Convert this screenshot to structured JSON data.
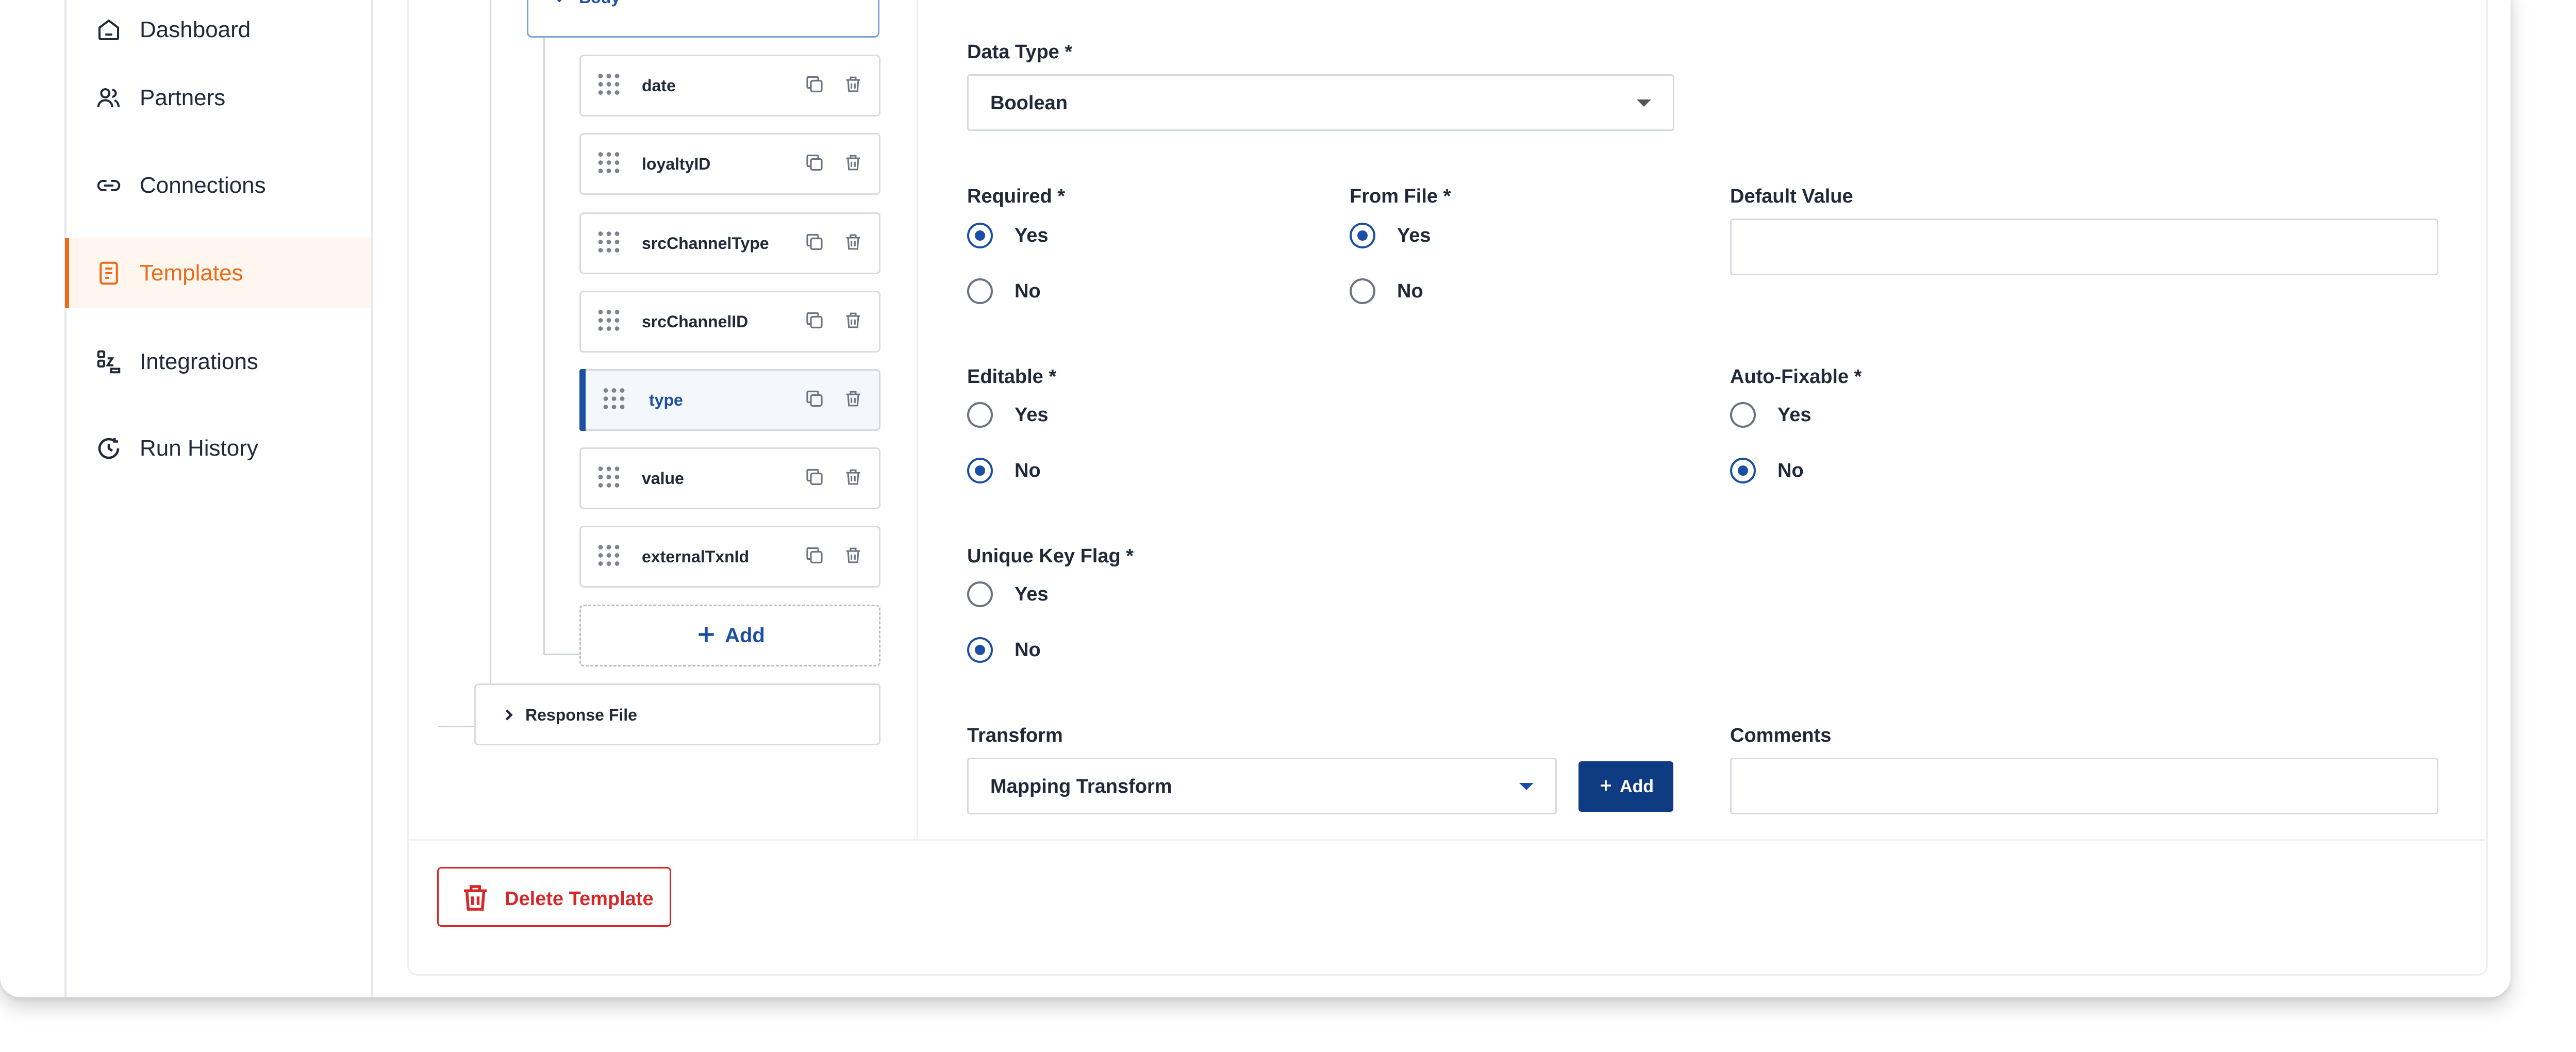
{
  "sidebar": {
    "items": [
      {
        "label": "Dashboard",
        "icon": "home-icon"
      },
      {
        "label": "Partners",
        "icon": "users-icon"
      },
      {
        "label": "Connections",
        "icon": "link-icon"
      },
      {
        "label": "Templates",
        "icon": "document-icon",
        "active": true
      },
      {
        "label": "Integrations",
        "icon": "integrations-icon"
      },
      {
        "label": "Run History",
        "icon": "history-icon"
      }
    ]
  },
  "tree": {
    "body_label": "Body",
    "fields": [
      {
        "label": "date"
      },
      {
        "label": "loyaltyID"
      },
      {
        "label": "srcChannelType"
      },
      {
        "label": "srcChannelID"
      },
      {
        "label": "type",
        "selected": true
      },
      {
        "label": "value"
      },
      {
        "label": "externalTxnId"
      }
    ],
    "add_label": "Add",
    "response_label": "Response File"
  },
  "form": {
    "data_type": {
      "label": "Data Type *",
      "value": "Boolean"
    },
    "required": {
      "label": "Required *",
      "yes": "Yes",
      "no": "No",
      "selected": "Yes"
    },
    "from_file": {
      "label": "From File *",
      "yes": "Yes",
      "no": "No",
      "selected": "Yes"
    },
    "default_value": {
      "label": "Default Value",
      "value": ""
    },
    "editable": {
      "label": "Editable *",
      "yes": "Yes",
      "no": "No",
      "selected": "No"
    },
    "auto_fixable": {
      "label": "Auto-Fixable *",
      "yes": "Yes",
      "no": "No",
      "selected": "No"
    },
    "unique_key": {
      "label": "Unique Key Flag *",
      "yes": "Yes",
      "no": "No",
      "selected": "No"
    },
    "transform": {
      "label": "Transform",
      "value": "Mapping Transform",
      "add_label": "Add"
    },
    "comments": {
      "label": "Comments",
      "value": ""
    }
  },
  "footer": {
    "delete_label": "Delete Template"
  },
  "colors": {
    "accent": "#ea6a17",
    "primary": "#1c4fa3",
    "danger": "#d62828",
    "button": "#0f3b82"
  }
}
